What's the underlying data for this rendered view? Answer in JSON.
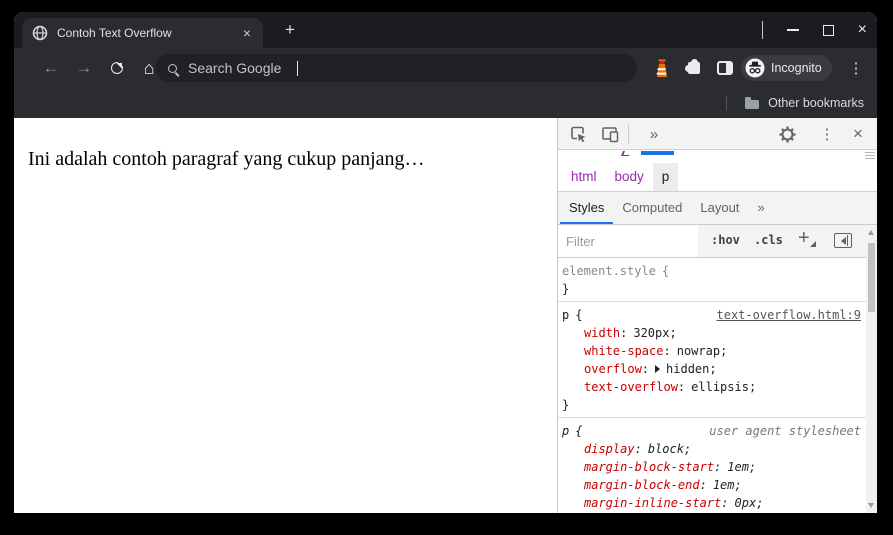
{
  "browser": {
    "tab_title": "Contoh Text Overflow",
    "omnibox_text": "Search Google",
    "incognito_label": "Incognito",
    "other_bookmarks_label": "Other bookmarks"
  },
  "page": {
    "paragraph": "Ini adalah contoh paragraf yang cukup panjang…"
  },
  "devtools": {
    "breadcrumb": [
      "html",
      "body",
      "p"
    ],
    "panel_tabs": [
      "Styles",
      "Computed",
      "Layout",
      "»"
    ],
    "filter_placeholder": "Filter",
    "pseudo_toggle": ":hov",
    "class_toggle": ".cls",
    "punct": {
      "open": "{",
      "close": "}",
      "colon": ":",
      "semi": ";"
    },
    "rules": {
      "element_style": {
        "selector": "element.style"
      },
      "rule1": {
        "selector": "p",
        "source": "text-overflow.html:9",
        "properties": [
          {
            "name": "width",
            "value": "320px"
          },
          {
            "name": "white-space",
            "value": "nowrap"
          },
          {
            "name": "overflow",
            "value": "hidden",
            "expandable": true
          },
          {
            "name": "text-overflow",
            "value": "ellipsis"
          }
        ]
      },
      "rule2": {
        "selector": "p",
        "source": "user agent stylesheet",
        "properties": [
          {
            "name": "display",
            "value": "block"
          },
          {
            "name": "margin-block-start",
            "value": "1em"
          },
          {
            "name": "margin-block-end",
            "value": "1em"
          },
          {
            "name": "margin-inline-start",
            "value": "0px"
          }
        ]
      }
    }
  },
  "icons": {
    "tab_close": "×",
    "new_tab": "+",
    "window_close": "×",
    "back": "←",
    "forward": "→",
    "home": "⌂",
    "menu_kebab": "⋮",
    "devtools_kebab": "⋮",
    "devtools_close": "×",
    "more_panels": "»",
    "add_rule": "+"
  },
  "colors": {
    "accent_blue": "#1a73e8",
    "property_red": "#c80000",
    "breadcrumb_purple": "#9c27b0",
    "frame_dark": "#1b1c1f",
    "toolbar_dark": "#2b2c2f"
  }
}
